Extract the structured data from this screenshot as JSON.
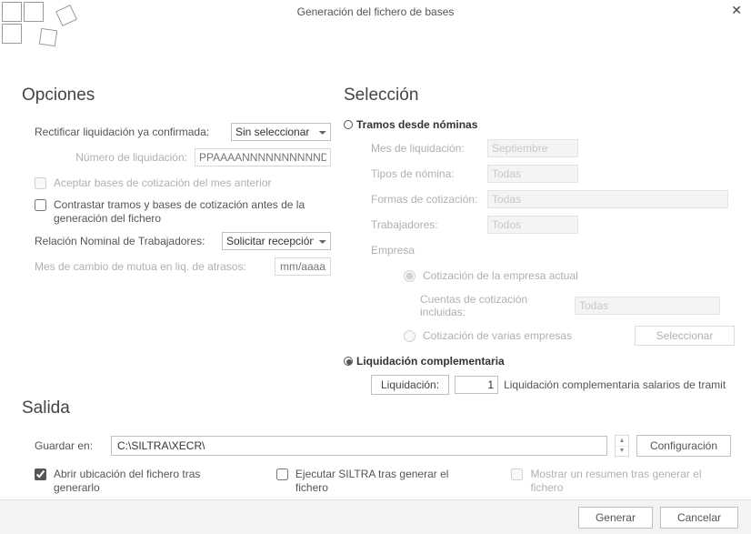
{
  "window": {
    "title": "Generación del fichero de bases"
  },
  "opciones": {
    "heading": "Opciones",
    "rectificar_lbl": "Rectificar liquidación ya confirmada:",
    "rectificar_sel": "Sin seleccionar",
    "numliq_lbl": "Número de liquidación:",
    "numliq_placeholder": "PPAAAANNNNNNNNNNDC",
    "cb_aceptar": "Aceptar bases de cotización del mes anterior",
    "cb_contrastar": "Contrastar tramos y bases de cotización antes de la generación del fichero",
    "rnt_lbl": "Relación Nominal de Trabajadores:",
    "rnt_sel": "Solicitar recepción",
    "mes_mutua_lbl": "Mes de cambio de mutua en liq. de atrasos:",
    "mes_mutua_placeholder": "mm/aaaa"
  },
  "seleccion": {
    "heading": "Selección",
    "tramos_head": "Tramos desde nóminas",
    "mes_lbl": "Mes de liquidación:",
    "mes_val": "Septiembre",
    "tipos_lbl": "Tipos de nómina:",
    "tipos_val": "Todas",
    "formas_lbl": "Formas de cotización:",
    "formas_val": "Todas",
    "trab_lbl": "Trabajadores:",
    "trab_val": "Todos",
    "empresa_lbl": "Empresa",
    "cot_actual": "Cotización de la empresa actual",
    "cuentas_lbl": "Cuentas de cotización incluidas:",
    "cuentas_val": "Todas",
    "cot_varias": "Cotización de varias empresas",
    "seleccionar_btn": "Seleccionar",
    "liq_comp_head": "Liquidación complementaria",
    "liq_btn": "Liquidación:",
    "liq_num": "1",
    "liq_desc": "Liquidación complementaria salarios de tramit"
  },
  "salida": {
    "heading": "Salida",
    "guardar_lbl": "Guardar en:",
    "path": "C:\\SILTRA\\XECR\\",
    "config_btn": "Configuración",
    "cb_abrir": "Abrir ubicación del fichero tras generarlo",
    "cb_ejecutar": "Ejecutar SILTRA tras generar el fichero",
    "cb_resumen": "Mostrar un resumen tras generar el fichero"
  },
  "footer": {
    "generar": "Generar",
    "cancelar": "Cancelar"
  }
}
